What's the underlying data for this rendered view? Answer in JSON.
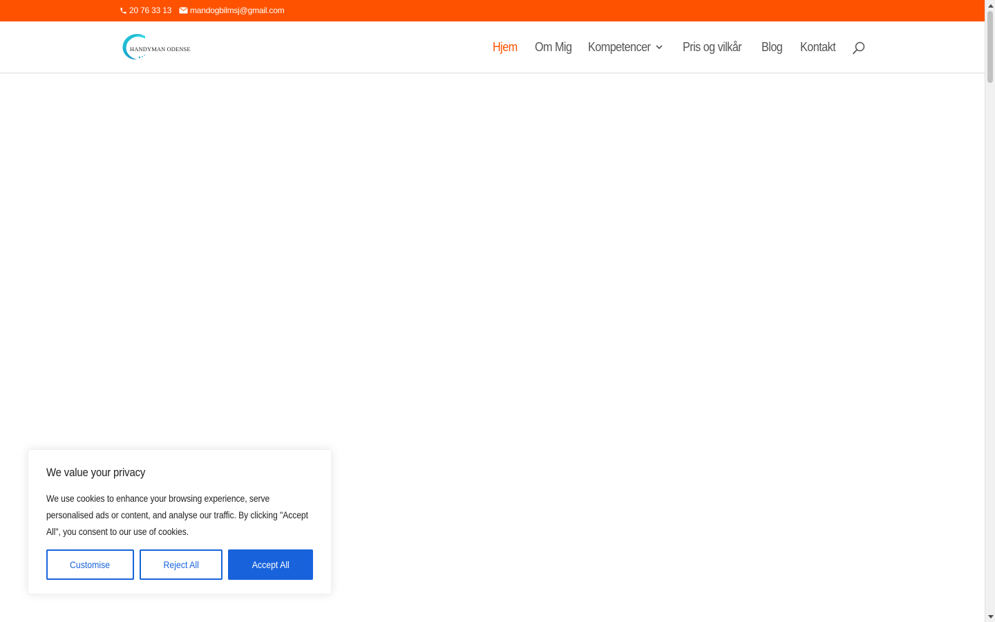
{
  "topbar": {
    "phone": "20 76 33 13",
    "email": "mandogbilmsj@gmail.com",
    "background": "#ff5200"
  },
  "logo": {
    "text": "HANDYMAN ODENSE"
  },
  "nav": {
    "items": [
      {
        "label": "Hjem",
        "active": true
      },
      {
        "label": "Om Mig",
        "active": false
      },
      {
        "label": "Kompetencer",
        "active": false,
        "has_dropdown": true
      },
      {
        "label": "Pris og vilkår",
        "active": false
      },
      {
        "label": "Blog",
        "active": false
      },
      {
        "label": "Kontakt",
        "active": false
      }
    ],
    "active_color": "#ff5200",
    "text_color": "#555555"
  },
  "cookie": {
    "title": "We value your privacy",
    "body": "We use cookies to enhance your browsing experience, serve personalised ads or content, and analyse our traffic. By clicking \"Accept All\", you consent to our use of cookies.",
    "customise_label": "Customise",
    "reject_label": "Reject All",
    "accept_label": "Accept All",
    "accent_color": "#1863dc"
  }
}
